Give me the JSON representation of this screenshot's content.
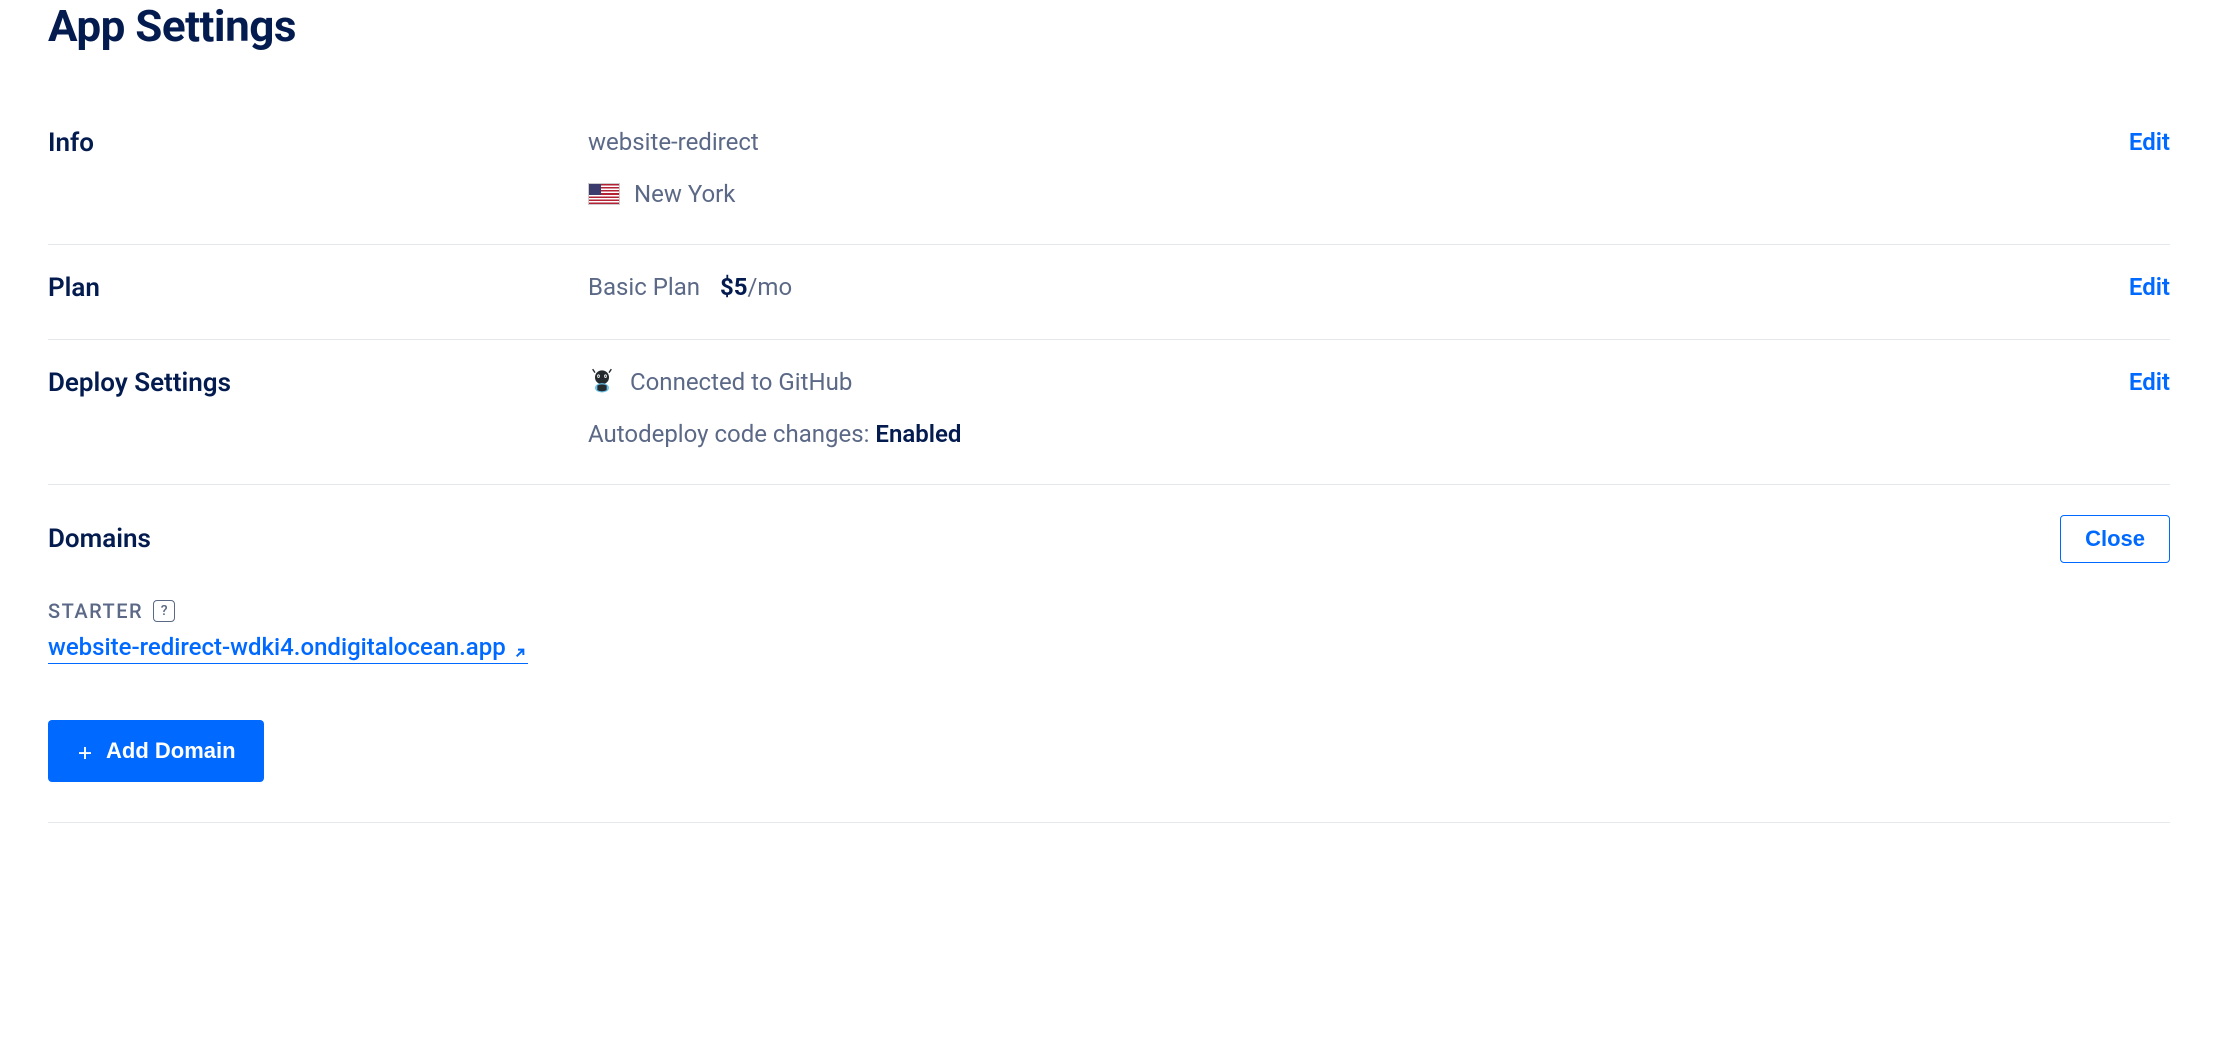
{
  "page": {
    "title": "App Settings"
  },
  "info": {
    "label": "Info",
    "app_name": "website-redirect",
    "region": "New York",
    "edit": "Edit"
  },
  "plan": {
    "label": "Plan",
    "name": "Basic Plan",
    "price": "$5",
    "period": "/mo",
    "edit": "Edit"
  },
  "deploy": {
    "label": "Deploy Settings",
    "connected_text": "Connected to GitHub",
    "autodeploy_label": "Autodeploy code changes: ",
    "autodeploy_value": "Enabled",
    "edit": "Edit"
  },
  "domains": {
    "label": "Domains",
    "close": "Close",
    "tier_label": "STARTER",
    "domain_url": "website-redirect-wdki4.ondigitalocean.app",
    "add_domain": "Add Domain"
  }
}
